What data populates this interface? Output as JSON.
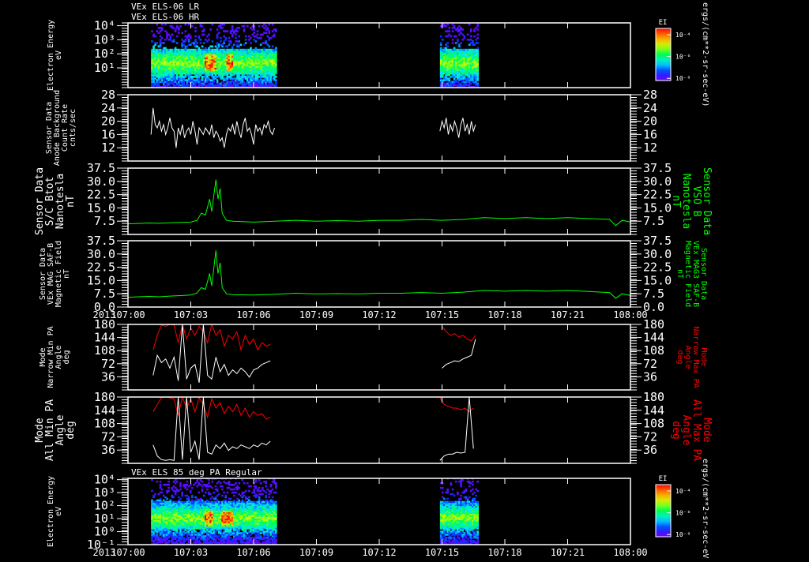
{
  "colors": {
    "background": "#000000",
    "axis": "#ffffff",
    "bfield": "#00ff00",
    "pa_max": "#ff0000",
    "pa_min": "#ffffff"
  },
  "titles": {
    "lr": "VEx ELS-06 LR",
    "hr": "VEx ELS-06 HR",
    "pa85": "VEx ELS 85 deg PA Regular"
  },
  "colorbar": {
    "title": "EI",
    "ticks": [
      "10⁻⁴",
      "10⁻⁶",
      "10⁻⁸"
    ],
    "unit": "ergs/(cm**2-sr-sec-eV)"
  },
  "x_axis": {
    "year": "2013",
    "ticks": [
      "107:00",
      "107:03",
      "107:06",
      "107:09",
      "107:12",
      "107:15",
      "107:18",
      "107:21",
      "108:00"
    ],
    "range_hours": [
      0,
      24
    ]
  },
  "chart_data": [
    {
      "type": "heatmap",
      "name": "spectrogram-top",
      "ylabel": [
        "Electron Energy",
        "eV"
      ],
      "yscale": "log",
      "ylim": [
        -0.4,
        4.2
      ],
      "ytick_labels": [
        {
          "v": 4,
          "t": "10⁴"
        },
        {
          "v": 3,
          "t": "10³"
        },
        {
          "v": 2,
          "t": "10²"
        },
        {
          "v": 1,
          "t": "10¹"
        }
      ],
      "segments": [
        [
          1.1,
          7.05
        ],
        [
          14.9,
          16.7
        ]
      ],
      "peak_log_energy": 1.3,
      "hotspots": [
        [
          3.6,
          4.2
        ],
        [
          4.7,
          5.0
        ]
      ]
    },
    {
      "type": "line",
      "name": "background-rate",
      "ylabel": [
        "Sensor Data",
        "Anode Background",
        "Count Rate",
        "cnts/sec"
      ],
      "ylim": [
        8,
        28
      ],
      "ytick_labels": [
        {
          "v": 28,
          "t": "28"
        },
        {
          "v": 24,
          "t": "24"
        },
        {
          "v": 20,
          "t": "20"
        },
        {
          "v": 16,
          "t": "16"
        },
        {
          "v": 12,
          "t": "12"
        }
      ],
      "series": [
        {
          "color": "#ffffff",
          "segments": [
            {
              "t0": 1.1,
              "dt": 0.1,
              "values": [
                16,
                24,
                19,
                18,
                20,
                17,
                19,
                16,
                18,
                21,
                18,
                17,
                12,
                18,
                16,
                19,
                15,
                17,
                18,
                16,
                20,
                17,
                13,
                18,
                17,
                16,
                18,
                17,
                16,
                19,
                15,
                17,
                16,
                14,
                15,
                12,
                16,
                18,
                17,
                19,
                16,
                20,
                17,
                15,
                19,
                21,
                17,
                18,
                16,
                13,
                19,
                17,
                18,
                16,
                19,
                18,
                20,
                17,
                16,
                18
              ]
            },
            {
              "t0": 14.9,
              "dt": 0.1,
              "values": [
                17,
                20,
                18,
                21,
                16,
                19,
                17,
                20,
                18,
                15,
                19,
                21,
                17,
                19,
                16,
                20,
                17,
                19
              ]
            }
          ]
        }
      ]
    },
    {
      "type": "line",
      "name": "bfield-total",
      "ylabel": [
        "Sensor Data",
        "S/C Btot",
        "Nanotesla",
        "nT"
      ],
      "ylabel_right": [
        "Sensor Data",
        "VSO B",
        "Nanotesla",
        "nT"
      ],
      "ylim": [
        0,
        37.5
      ],
      "ytick_labels": [
        {
          "v": 37.5,
          "t": "37.5"
        },
        {
          "v": 30,
          "t": "30.0"
        },
        {
          "v": 22.5,
          "t": "22.5"
        },
        {
          "v": 15,
          "t": "15.0"
        },
        {
          "v": 7.5,
          "t": "7.5"
        }
      ],
      "series": [
        {
          "color": "#00ff00",
          "points": [
            [
              0,
              6
            ],
            [
              0.5,
              6.2
            ],
            [
              1,
              6.5
            ],
            [
              1.5,
              6.3
            ],
            [
              2,
              6.6
            ],
            [
              2.5,
              6.8
            ],
            [
              3,
              7
            ],
            [
              3.3,
              8
            ],
            [
              3.5,
              12
            ],
            [
              3.7,
              11
            ],
            [
              3.9,
              20
            ],
            [
              4.0,
              13
            ],
            [
              4.1,
              22
            ],
            [
              4.2,
              31
            ],
            [
              4.3,
              20
            ],
            [
              4.4,
              26
            ],
            [
              4.5,
              12
            ],
            [
              4.7,
              8
            ],
            [
              5,
              7.5
            ],
            [
              6,
              7
            ],
            [
              7,
              7.5
            ],
            [
              8,
              8
            ],
            [
              9,
              7.5
            ],
            [
              10,
              7.8
            ],
            [
              11,
              7.5
            ],
            [
              12,
              8
            ],
            [
              13,
              8
            ],
            [
              14,
              8.5
            ],
            [
              15,
              8
            ],
            [
              16,
              8.5
            ],
            [
              17,
              9.5
            ],
            [
              18,
              9
            ],
            [
              19,
              9.5
            ],
            [
              20,
              9
            ],
            [
              21,
              9.5
            ],
            [
              22,
              9
            ],
            [
              23,
              8.5
            ],
            [
              23.3,
              5
            ],
            [
              23.6,
              8
            ],
            [
              24,
              7
            ]
          ]
        }
      ]
    },
    {
      "type": "line",
      "name": "bfield-mag3",
      "ylabel": [
        "Sensor Data",
        "VEx MAG SAF-B",
        "Magnetic Field",
        "nT"
      ],
      "ylabel_right": [
        "Sensor Data",
        "VEx MAG3 SAF-B",
        "Magnetic Field",
        "nT"
      ],
      "ylim": [
        0,
        37.5
      ],
      "ytick_labels": [
        {
          "v": 37.5,
          "t": "37.5"
        },
        {
          "v": 30,
          "t": "30.0"
        },
        {
          "v": 22.5,
          "t": "22.5"
        },
        {
          "v": 15,
          "t": "15.0"
        },
        {
          "v": 7.5,
          "t": "7.5"
        },
        {
          "v": 0,
          "t": "0.0"
        }
      ],
      "series": [
        {
          "color": "#00ff00",
          "points": [
            [
              0,
              5.5
            ],
            [
              0.5,
              5.8
            ],
            [
              1,
              6
            ],
            [
              1.5,
              5.8
            ],
            [
              2,
              6.2
            ],
            [
              2.5,
              6.5
            ],
            [
              3,
              6.8
            ],
            [
              3.3,
              8
            ],
            [
              3.5,
              11
            ],
            [
              3.7,
              10
            ],
            [
              3.9,
              19
            ],
            [
              4.0,
              12
            ],
            [
              4.1,
              22
            ],
            [
              4.2,
              32
            ],
            [
              4.3,
              19
            ],
            [
              4.4,
              25
            ],
            [
              4.5,
              11
            ],
            [
              4.7,
              7.5
            ],
            [
              5,
              7
            ],
            [
              6,
              6.8
            ],
            [
              7,
              7.2
            ],
            [
              8,
              7.8
            ],
            [
              9,
              7.4
            ],
            [
              10,
              7.6
            ],
            [
              11,
              7.4
            ],
            [
              12,
              7.8
            ],
            [
              13,
              7.8
            ],
            [
              14,
              8.2
            ],
            [
              15,
              7.8
            ],
            [
              16,
              8.4
            ],
            [
              17,
              9.4
            ],
            [
              18,
              9
            ],
            [
              19,
              9.4
            ],
            [
              20,
              9
            ],
            [
              21,
              9.4
            ],
            [
              22,
              8.8
            ],
            [
              23,
              8.2
            ],
            [
              23.3,
              5
            ],
            [
              23.6,
              7.5
            ],
            [
              24,
              6.5
            ]
          ]
        }
      ]
    },
    {
      "type": "line",
      "name": "narrow-pa",
      "ylabel": [
        "Mode",
        "Narrow Min PA",
        "Angle",
        "deg"
      ],
      "ylabel_right": [
        "Mode",
        "Narrow Max PA",
        "Angle",
        "deg"
      ],
      "ylim": [
        0,
        180
      ],
      "ytick_labels": [
        {
          "v": 180,
          "t": "180"
        },
        {
          "v": 144,
          "t": "144"
        },
        {
          "v": 108,
          "t": "108"
        },
        {
          "v": 72,
          "t": "72"
        },
        {
          "v": 36,
          "t": "36"
        }
      ],
      "series": [
        {
          "color": "#ff0000",
          "segments": [
            {
              "t0": 1.2,
              "dt": 0.2,
              "values": [
                110,
                150,
                178,
                175,
                180,
                178,
                130,
                180,
                140,
                170,
                150,
                175,
                160,
                130,
                180,
                150,
                165,
                120,
                150,
                140,
                160,
                110,
                150,
                125,
                140,
                110,
                130,
                120,
                125
              ]
            },
            {
              "t0": 15.0,
              "dt": 0.2,
              "values": [
                175,
                160,
                150,
                155,
                145,
                150,
                140,
                135,
                150
              ]
            }
          ]
        },
        {
          "color": "#ffffff",
          "segments": [
            {
              "t0": 1.2,
              "dt": 0.2,
              "values": [
                40,
                95,
                75,
                85,
                60,
                90,
                25,
                180,
                30,
                60,
                70,
                20,
                180,
                40,
                30,
                90,
                50,
                70,
                40,
                55,
                45,
                60,
                50,
                35,
                55,
                60,
                70,
                75,
                80
              ]
            },
            {
              "t0": 15.0,
              "dt": 0.2,
              "values": [
                60,
                70,
                75,
                80,
                78,
                85,
                90,
                95,
                140
              ]
            }
          ]
        }
      ]
    },
    {
      "type": "line",
      "name": "all-pa",
      "ylabel": [
        "Mode",
        "All Min PA",
        "Angle",
        "deg"
      ],
      "ylabel_right": [
        "Mode",
        "All Max PA",
        "Angle",
        "deg"
      ],
      "ylim": [
        0,
        180
      ],
      "ytick_labels": [
        {
          "v": 180,
          "t": "180"
        },
        {
          "v": 144,
          "t": "144"
        },
        {
          "v": 108,
          "t": "108"
        },
        {
          "v": 72,
          "t": "72"
        },
        {
          "v": 36,
          "t": "36"
        }
      ],
      "series": [
        {
          "color": "#ff0000",
          "segments": [
            {
              "t0": 1.2,
              "dt": 0.2,
              "values": [
                140,
                160,
                178,
                180,
                178,
                175,
                130,
                180,
                150,
                175,
                140,
                178,
                160,
                125,
                175,
                150,
                165,
                135,
                155,
                140,
                160,
                130,
                150,
                125,
                140,
                130,
                135,
                120,
                125
              ]
            },
            {
              "t0": 14.9,
              "dt": 0.2,
              "values": [
                178,
                160,
                155,
                150,
                150,
                145,
                150,
                140,
                150
              ]
            }
          ]
        },
        {
          "color": "#ffffff",
          "segments": [
            {
              "t0": 1.2,
              "dt": 0.2,
              "values": [
                50,
                20,
                10,
                8,
                10,
                8,
                180,
                10,
                180,
                30,
                60,
                10,
                180,
                30,
                25,
                50,
                40,
                55,
                35,
                45,
                40,
                50,
                45,
                40,
                50,
                45,
                55,
                50,
                60
              ]
            },
            {
              "t0": 14.9,
              "dt": 0.2,
              "values": [
                8,
                20,
                25,
                25,
                30,
                28,
                30,
                180,
                40
              ]
            }
          ]
        }
      ]
    },
    {
      "type": "heatmap",
      "name": "spectrogram-85deg",
      "ylabel": [
        "Electron Energy",
        "eV"
      ],
      "yscale": "log",
      "ylim": [
        -1,
        4.1
      ],
      "ytick_labels": [
        {
          "v": 4,
          "t": "10⁴"
        },
        {
          "v": 3,
          "t": "10³"
        },
        {
          "v": 2,
          "t": "10²"
        },
        {
          "v": 1,
          "t": "10¹"
        },
        {
          "v": 0,
          "t": "10⁰"
        },
        {
          "v": -1,
          "t": "10⁻¹"
        }
      ],
      "segments": [
        [
          1.1,
          7.05
        ],
        [
          14.9,
          16.7
        ]
      ],
      "peak_log_energy": 1.0,
      "hotspots": [
        [
          3.6,
          4.0
        ],
        [
          4.4,
          5.0
        ]
      ]
    }
  ]
}
